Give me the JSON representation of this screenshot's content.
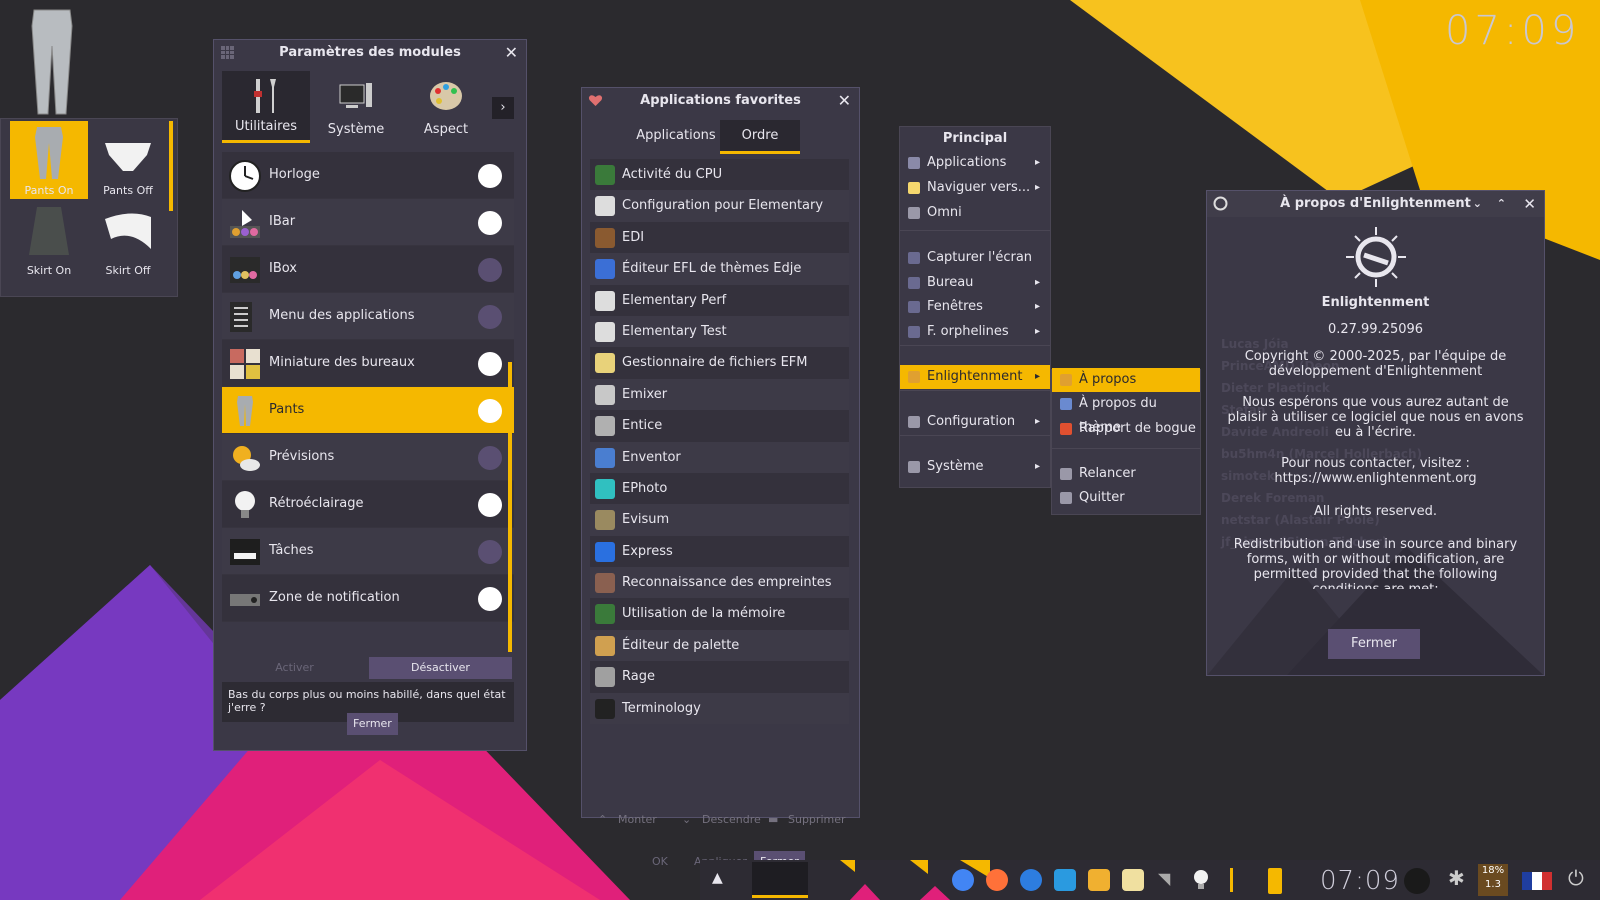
{
  "desktop": {
    "clock": "07:09"
  },
  "pants_gadget": {
    "items": [
      {
        "label": "Pants On",
        "selected": true
      },
      {
        "label": "Pants Off",
        "selected": false
      },
      {
        "label": "Skirt On",
        "selected": false
      },
      {
        "label": "Skirt Off",
        "selected": false
      }
    ]
  },
  "modules_window": {
    "title": "Paramètres des modules",
    "tabs": [
      "Utilitaires",
      "Système",
      "Aspect"
    ],
    "active_tab": "Utilitaires",
    "modules": [
      {
        "label": "Horloge",
        "enabled": true
      },
      {
        "label": "IBar",
        "enabled": true
      },
      {
        "label": "IBox",
        "enabled": false
      },
      {
        "label": "Menu des applications",
        "enabled": false
      },
      {
        "label": "Miniature des bureaux",
        "enabled": true
      },
      {
        "label": "Pants",
        "enabled": true,
        "selected": true
      },
      {
        "label": "Prévisions",
        "enabled": false
      },
      {
        "label": "Rétroéclairage",
        "enabled": true
      },
      {
        "label": "Tâches",
        "enabled": false
      },
      {
        "label": "Zone de notification",
        "enabled": true
      }
    ],
    "activate_label": "Activer",
    "deactivate_label": "Désactiver",
    "description": "Bas du corps plus ou moins habillé, dans quel état j'erre ?",
    "close_label": "Fermer"
  },
  "favorites_window": {
    "title": "Applications favorites",
    "tabs": [
      "Applications",
      "Ordre"
    ],
    "active_tab": "Ordre",
    "apps": [
      {
        "label": "Activité du CPU",
        "icon": "cpu-icon",
        "color": "#3a7a3a"
      },
      {
        "label": "Configuration pour Elementary",
        "icon": "elementary-icon",
        "color": "#dddddd"
      },
      {
        "label": "EDI",
        "icon": "edi-icon",
        "color": "#8a5a30"
      },
      {
        "label": "Éditeur EFL de thèmes Edje",
        "icon": "edje-icon",
        "color": "#3b6fd6"
      },
      {
        "label": "Elementary Perf",
        "icon": "elementary-icon",
        "color": "#dddddd"
      },
      {
        "label": "Elementary Test",
        "icon": "elementary-icon",
        "color": "#dddddd"
      },
      {
        "label": "Gestionnaire de fichiers EFM",
        "icon": "file-manager-icon",
        "color": "#e8d27a"
      },
      {
        "label": "Emixer",
        "icon": "mixer-icon",
        "color": "#c8c8c8"
      },
      {
        "label": "Entice",
        "icon": "eye-icon",
        "color": "#b0b0b0"
      },
      {
        "label": "Enventor",
        "icon": "enventor-icon",
        "color": "#4a7ed0"
      },
      {
        "label": "EPhoto",
        "icon": "photo-icon",
        "color": "#30c0c0"
      },
      {
        "label": "Evisum",
        "icon": "evisum-icon",
        "color": "#9a8a60"
      },
      {
        "label": "Express",
        "icon": "express-icon",
        "color": "#2a70e0"
      },
      {
        "label": "Reconnaissance des empreintes",
        "icon": "fingerprint-icon",
        "color": "#8a6050"
      },
      {
        "label": "Utilisation de la mémoire",
        "icon": "memory-icon",
        "color": "#3a7a3a"
      },
      {
        "label": "Éditeur de palette",
        "icon": "palette-icon",
        "color": "#d0a050"
      },
      {
        "label": "Rage",
        "icon": "rage-icon",
        "color": "#a0a0a0"
      },
      {
        "label": "Terminology",
        "icon": "terminal-icon",
        "color": "#222222"
      }
    ],
    "move_up_label": "Monter",
    "move_down_label": "Descendre",
    "delete_label": "Supprimer",
    "ok_label": "OK",
    "apply_label": "Appliquer",
    "close_label": "Fermer"
  },
  "main_menu": {
    "title": "Principal",
    "items": [
      {
        "label": "Applications",
        "submenu": true,
        "icon": "applications-icon",
        "color": "#8a8aa8"
      },
      {
        "label": "Naviguer vers...",
        "submenu": true,
        "icon": "folder-icon",
        "color": "#f5d76e"
      },
      {
        "label": "Omni",
        "submenu": false,
        "icon": "gear-icon",
        "color": "#9a98a8"
      },
      {
        "label": "Capturer l'écran",
        "submenu": false,
        "icon": "screenshot-icon",
        "color": "#6a6a90"
      },
      {
        "label": "Bureau",
        "submenu": true,
        "icon": "desktop-icon",
        "color": "#6a6a90"
      },
      {
        "label": "Fenêtres",
        "submenu": true,
        "icon": "windows-icon",
        "color": "#6a6a90"
      },
      {
        "label": "F. orphelines",
        "submenu": true,
        "icon": "orphans-icon",
        "color": "#6a6a90"
      },
      {
        "label": "Enlightenment",
        "submenu": true,
        "selected": true,
        "icon": "enlightenment-icon",
        "color": "#e0a030"
      },
      {
        "label": "Configuration",
        "submenu": true,
        "icon": "gear-icon",
        "color": "#9a98a8"
      },
      {
        "label": "Système",
        "submenu": true,
        "icon": "system-icon",
        "color": "#9a98a8"
      }
    ]
  },
  "enlightenment_submenu": {
    "items": [
      {
        "label": "À propos",
        "selected": true,
        "icon": "enlightenment-icon",
        "color": "#e0a030"
      },
      {
        "label": "À propos du thème",
        "icon": "theme-icon",
        "color": "#6a8ad0"
      },
      {
        "label": "Rapport de bogue",
        "icon": "warning-icon",
        "color": "#e05030"
      },
      {
        "label": "Relancer",
        "icon": "restart-icon",
        "color": "#9a98a8"
      },
      {
        "label": "Quitter",
        "icon": "quit-icon",
        "color": "#9a98a8"
      }
    ]
  },
  "about_window": {
    "title": "À propos d'Enlightenment",
    "app_name": "Enlightenment",
    "version": "0.27.99.25096",
    "copyright": "Copyright © 2000-2025, par l'équipe de développement d'Enlightenment",
    "hope": "Nous espérons que vous aurez autant de plaisir à utiliser ce logiciel que nous en avons eu à l'écrire.",
    "contact": "Pour nous contacter, visitez :",
    "url": "https://www.enlightenment.org",
    "rights": "All rights reserved.",
    "license": "Redistribution and use in source and binary forms, with or without modification, are permitted provided that the following conditions are met:",
    "credits_visible": [
      "Lucas Jóia",
      "PrinceAMD (Deon",
      "Dieter Plaetinck",
      "Stefan",
      "Davide Andreoli",
      "bu5hm4n (Marcel Hollerbach)",
      "simotek",
      "Derek Foreman",
      "netstar (Alastair Poole)",
      "jf_simon (Simon Tischer)"
    ],
    "close_label": "Fermer"
  },
  "taskbar": {
    "clock": "07:09",
    "battery": "18%",
    "load": "1.3",
    "apps": [
      {
        "icon": "chrome-icon",
        "color": "#4285f4"
      },
      {
        "icon": "firefox-icon",
        "color": "#ff7139"
      },
      {
        "icon": "thunderbird-icon",
        "color": "#2d7de0"
      },
      {
        "icon": "vscode-icon",
        "color": "#2a9ae0"
      },
      {
        "icon": "package-icon",
        "color": "#f0b030"
      },
      {
        "icon": "notes-icon",
        "color": "#f0e0a0"
      }
    ]
  }
}
